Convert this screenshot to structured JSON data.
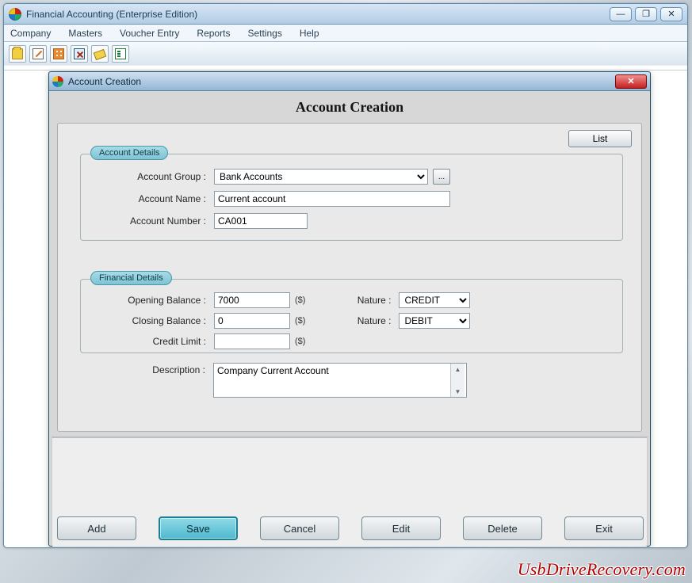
{
  "app": {
    "title": "Financial Accounting (Enterprise Edition)",
    "window_buttons": {
      "minimize": "—",
      "restore": "❐",
      "close": "✕"
    },
    "menu": [
      "Company",
      "Masters",
      "Voucher Entry",
      "Reports",
      "Settings",
      "Help"
    ]
  },
  "dialog": {
    "title": "Account Creation",
    "heading": "Account Creation",
    "list_button": "List",
    "close_glyph": "✕",
    "groups": {
      "account": {
        "legend": "Account Details",
        "fields": {
          "group_label": "Account Group  :",
          "group_value": "Bank Accounts",
          "group_browse": "...",
          "name_label": "Account Name  :",
          "name_value": "Current account",
          "number_label": "Account Number  :",
          "number_value": "CA001"
        }
      },
      "financial": {
        "legend": "Financial Details",
        "fields": {
          "opening_label": "Opening Balance  :",
          "opening_value": "7000",
          "opening_unit": "($)",
          "opening_nature_label": "Nature  :",
          "opening_nature_value": "CREDIT",
          "closing_label": "Closing Balance  :",
          "closing_value": "0",
          "closing_unit": "($)",
          "closing_nature_label": "Nature  :",
          "closing_nature_value": "DEBIT",
          "credit_limit_label": "Credit Limit  :",
          "credit_limit_value": "",
          "credit_limit_unit": "($)"
        }
      }
    },
    "description": {
      "label": "Description  :",
      "value": "Company Current Account"
    },
    "buttons": {
      "add": "Add",
      "save": "Save",
      "cancel": "Cancel",
      "edit": "Edit",
      "delete": "Delete",
      "exit": "Exit"
    }
  },
  "nature_options": [
    "CREDIT",
    "DEBIT"
  ],
  "watermark": "UsbDriveRecovery.com"
}
